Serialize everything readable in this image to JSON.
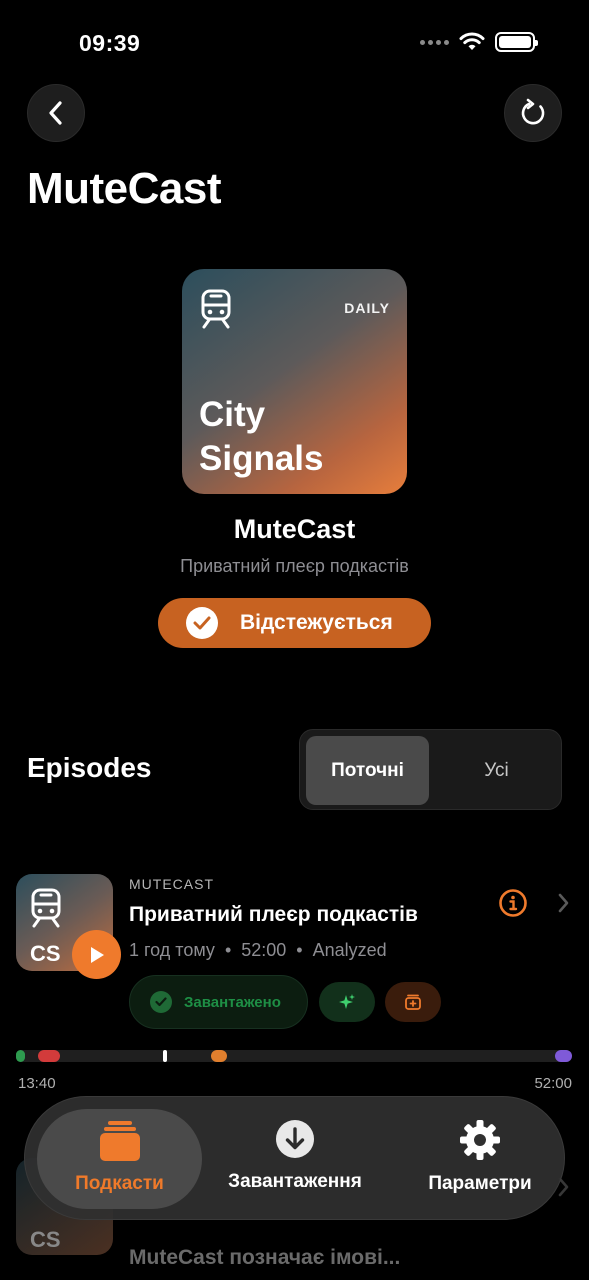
{
  "status_bar": {
    "time": "09:39"
  },
  "header": {
    "title": "MuteCast"
  },
  "artwork": {
    "badge": "DAILY",
    "title_line1": "City",
    "title_line2": "Signals"
  },
  "podcast": {
    "name": "MuteCast",
    "subtitle": "Приватний плеєр подкастів",
    "follow_label": "Відстежується"
  },
  "episodes": {
    "title": "Episodes",
    "segments": [
      "Поточні",
      "Усі"
    ],
    "selected_segment": "Поточні"
  },
  "episode": {
    "art_initials": "CS",
    "source": "MUTECAST",
    "title": "Приватний плеєр подкастів",
    "age": "1 год тому",
    "duration": "52:00",
    "status": "Analyzed",
    "downloaded_label": "Завантажено",
    "timeline_start": "13:40",
    "timeline_end": "52:00",
    "timeline_position": 0.265,
    "timeline_marks": [
      {
        "color": "#2e9b4f",
        "start": 0.0,
        "end": 0.012
      },
      {
        "color": "#d23b3b",
        "start": 0.04,
        "end": 0.08
      },
      {
        "color": "#e07f2e",
        "start": 0.35,
        "end": 0.38
      },
      {
        "color": "#7f5ad8",
        "start": 0.97,
        "end": 1.0
      }
    ]
  },
  "episode2": {
    "art_initials": "CS",
    "title": "MuteCast позначає імові..."
  },
  "tabbar": {
    "tabs": [
      {
        "label": "Подкасти",
        "icon": "podcasts-stack-icon",
        "active": true
      },
      {
        "label": "Завантаження",
        "icon": "download-circle-icon",
        "active": false
      },
      {
        "label": "Параметри",
        "icon": "gear-icon",
        "active": false
      }
    ]
  },
  "colors": {
    "accent": "#ef7a2c",
    "follow_button": "#c76221",
    "downloaded_green": "#1e8f45"
  }
}
